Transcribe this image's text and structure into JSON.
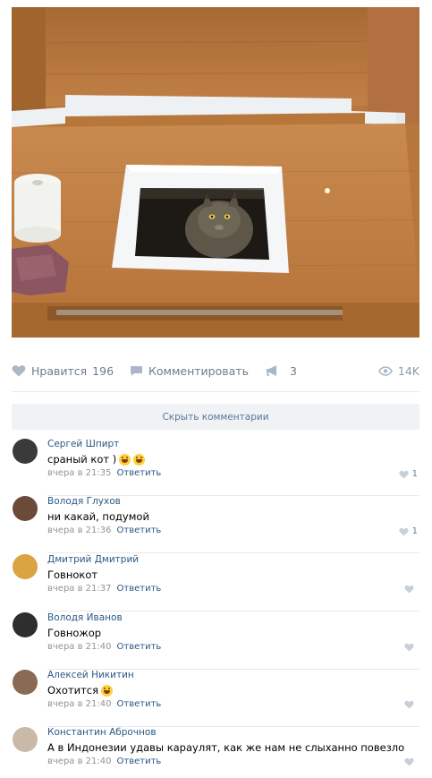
{
  "post": {
    "photo_icon": "cat-in-toilet-hole-photo"
  },
  "actions": {
    "like_label": "Нравится",
    "like_count": "196",
    "comment_label": "Комментировать",
    "share_count": "3",
    "views": "14K"
  },
  "comments_toggle": "Скрыть комментарии",
  "comments": [
    {
      "author": "Сергей Шпирт",
      "text": "сраный кот )",
      "emoji": "laughing-emoji",
      "time": "вчера в 21:35",
      "reply": "Ответить",
      "likes": "1",
      "avatar_color": "#3a3a3a"
    },
    {
      "author": "Володя Глухов",
      "text": "ни какай, подумой",
      "emoji": "",
      "time": "вчера в 21:36",
      "reply": "Ответить",
      "likes": "1",
      "avatar_color": "#6b4a3a"
    },
    {
      "author": "Дмитрий Дмитрий",
      "text": "Говнокот",
      "emoji": "",
      "time": "вчера в 21:37",
      "reply": "Ответить",
      "likes": "",
      "avatar_color": "#d9a441"
    },
    {
      "author": "Володя Иванов",
      "text": "Говножор",
      "emoji": "",
      "time": "вчера в 21:40",
      "reply": "Ответить",
      "likes": "",
      "avatar_color": "#2e2e2e"
    },
    {
      "author": "Алексей Никитин",
      "text": "Охотится",
      "emoji": "smiling-emoji",
      "time": "вчера в 21:40",
      "reply": "Ответить",
      "likes": "",
      "avatar_color": "#8a6a52"
    },
    {
      "author": "Константин Аброчнов",
      "text": "А в Индонезии удавы караулят, как же нам не слыханно повезло",
      "emoji": "",
      "time": "вчера в 21:40",
      "reply": "Ответить",
      "likes": "",
      "avatar_color": "#c9b9a8"
    }
  ]
}
